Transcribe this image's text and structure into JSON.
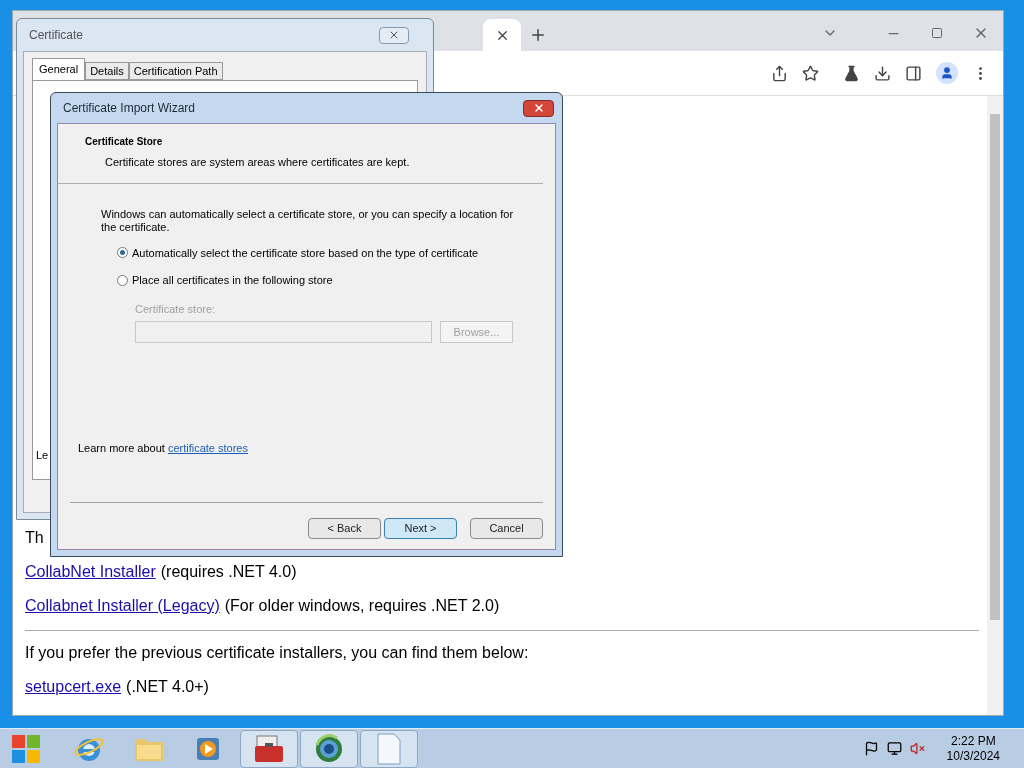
{
  "browser": {
    "page": {
      "cut_text": "Th",
      "lines": [
        {
          "link": "CollabNet Installer",
          "text": "(requires .NET 4.0)"
        },
        {
          "link": "Collabnet Installer (Legacy)",
          "text": "(For older windows, requires .NET 2.0)"
        }
      ],
      "note": "If you prefer the previous certificate installers, you can find them below:",
      "files": [
        {
          "link": "setupcert.exe",
          "text": "(.NET 4.0+)"
        }
      ]
    }
  },
  "certificate_dialog": {
    "title": "Certificate",
    "tabs": [
      {
        "label": "General",
        "selected": true
      },
      {
        "label": "Details",
        "selected": false
      },
      {
        "label": "Certification Path",
        "selected": false
      }
    ],
    "cut_text": "Le"
  },
  "wizard": {
    "title": "Certificate Import Wizard",
    "heading": "Certificate Store",
    "subheading": "Certificate stores are system areas where certificates are kept.",
    "intro": "Windows can automatically select a certificate store, or you can specify a location for the certificate.",
    "options": [
      {
        "label": "Automatically select the certificate store based on the type of certificate",
        "selected": true
      },
      {
        "label": "Place all certificates in the following store",
        "selected": false
      }
    ],
    "store": {
      "label": "Certificate store:",
      "disabled": true,
      "browse": "Browse..."
    },
    "learn_more": {
      "text": "Learn more about",
      "link": "certificate stores"
    },
    "buttons": [
      {
        "label": "< Back",
        "hovered": false
      },
      {
        "label": "Next >",
        "hovered": true
      },
      {
        "label": "Cancel",
        "hovered": false
      }
    ]
  },
  "taskbar": {
    "items": [
      {
        "kind": "ie",
        "active": false
      },
      {
        "kind": "folder",
        "active": false
      },
      {
        "kind": "media",
        "active": false
      },
      {
        "kind": "toolbox",
        "active": true
      },
      {
        "kind": "globe",
        "active": true
      },
      {
        "kind": "document",
        "active": true
      }
    ],
    "time": "2:22 PM",
    "date": "10/3/2024"
  }
}
